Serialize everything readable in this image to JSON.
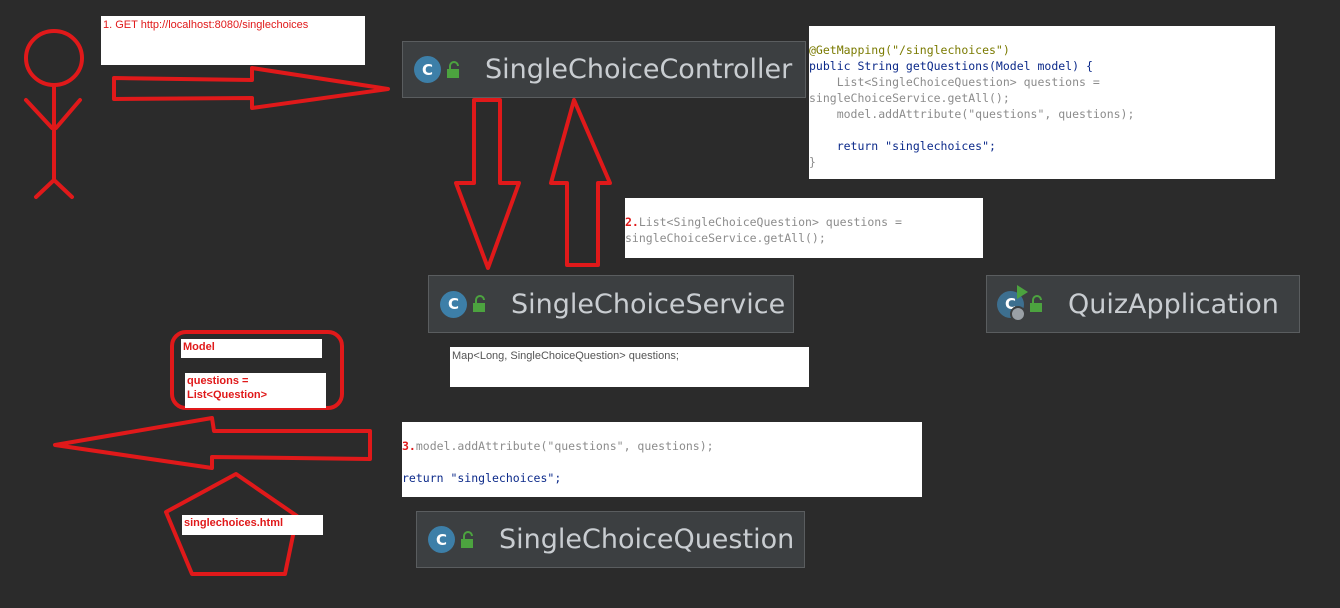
{
  "step1": {
    "text": "1. GET http://localhost:8080/singlechoices"
  },
  "controller_code": {
    "line1": "@GetMapping(\"/singlechoices\")",
    "line2": "public String getQuestions(Model model) {",
    "line3": "    List<SingleChoiceQuestion> questions =",
    "line4": "singleChoiceService.getAll();",
    "line5": "    model.addAttribute(\"questions\", questions);",
    "line6": "    return \"singlechoices\";",
    "line7": "}"
  },
  "step2": {
    "number": "2.",
    "line1": "List<SingleChoiceQuestion> questions =",
    "line2": "singleChoiceService.getAll();"
  },
  "service_note": {
    "text": "Map<Long, SingleChoiceQuestion> questions;"
  },
  "step3": {
    "number": "3.",
    "line1": "model.addAttribute(\"questions\", questions);",
    "line2": "return \"singlechoices\";"
  },
  "model_box": {
    "title": "Model",
    "line1": "questions =",
    "line2": "List<Question>"
  },
  "view": {
    "label": "singlechoices.html"
  },
  "classes": {
    "controller": "SingleChoiceController",
    "service": "SingleChoiceService",
    "app": "QuizApplication",
    "question": "SingleChoiceQuestion",
    "icon_letter": "C"
  },
  "colors": {
    "background": "#2b2b2b",
    "drawing_red": "#e0191a",
    "class_box": "#3c3f41"
  }
}
